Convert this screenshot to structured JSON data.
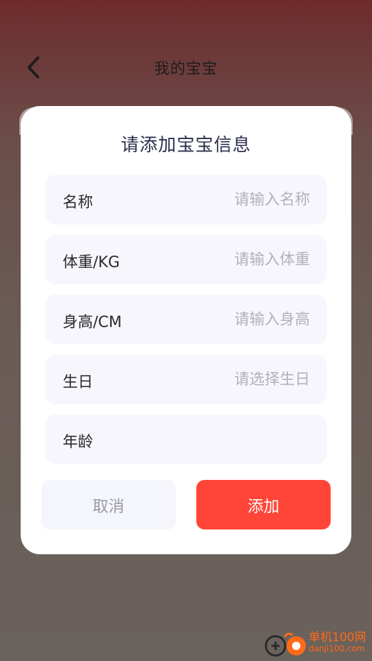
{
  "header": {
    "title": "我的宝宝",
    "back_icon": "chevron-left-icon"
  },
  "dialog": {
    "title": "请添加宝宝信息",
    "fields": [
      {
        "label": "名称",
        "placeholder": "请输入名称",
        "value": ""
      },
      {
        "label": "体重/KG",
        "placeholder": "请输入体重",
        "value": ""
      },
      {
        "label": "身高/CM",
        "placeholder": "请输入身高",
        "value": ""
      },
      {
        "label": "生日",
        "placeholder": "请选择生日",
        "value": ""
      },
      {
        "label": "年龄",
        "placeholder": "",
        "value": ""
      }
    ],
    "cancel_label": "取消",
    "add_label": "添加"
  },
  "watermark": {
    "name": "单机100网",
    "url": "danji100.com"
  },
  "colors": {
    "accent": "#ff4538",
    "field_bg": "#f6f6fc",
    "title_text": "#2b2d4a",
    "placeholder": "#b1b1b8"
  }
}
